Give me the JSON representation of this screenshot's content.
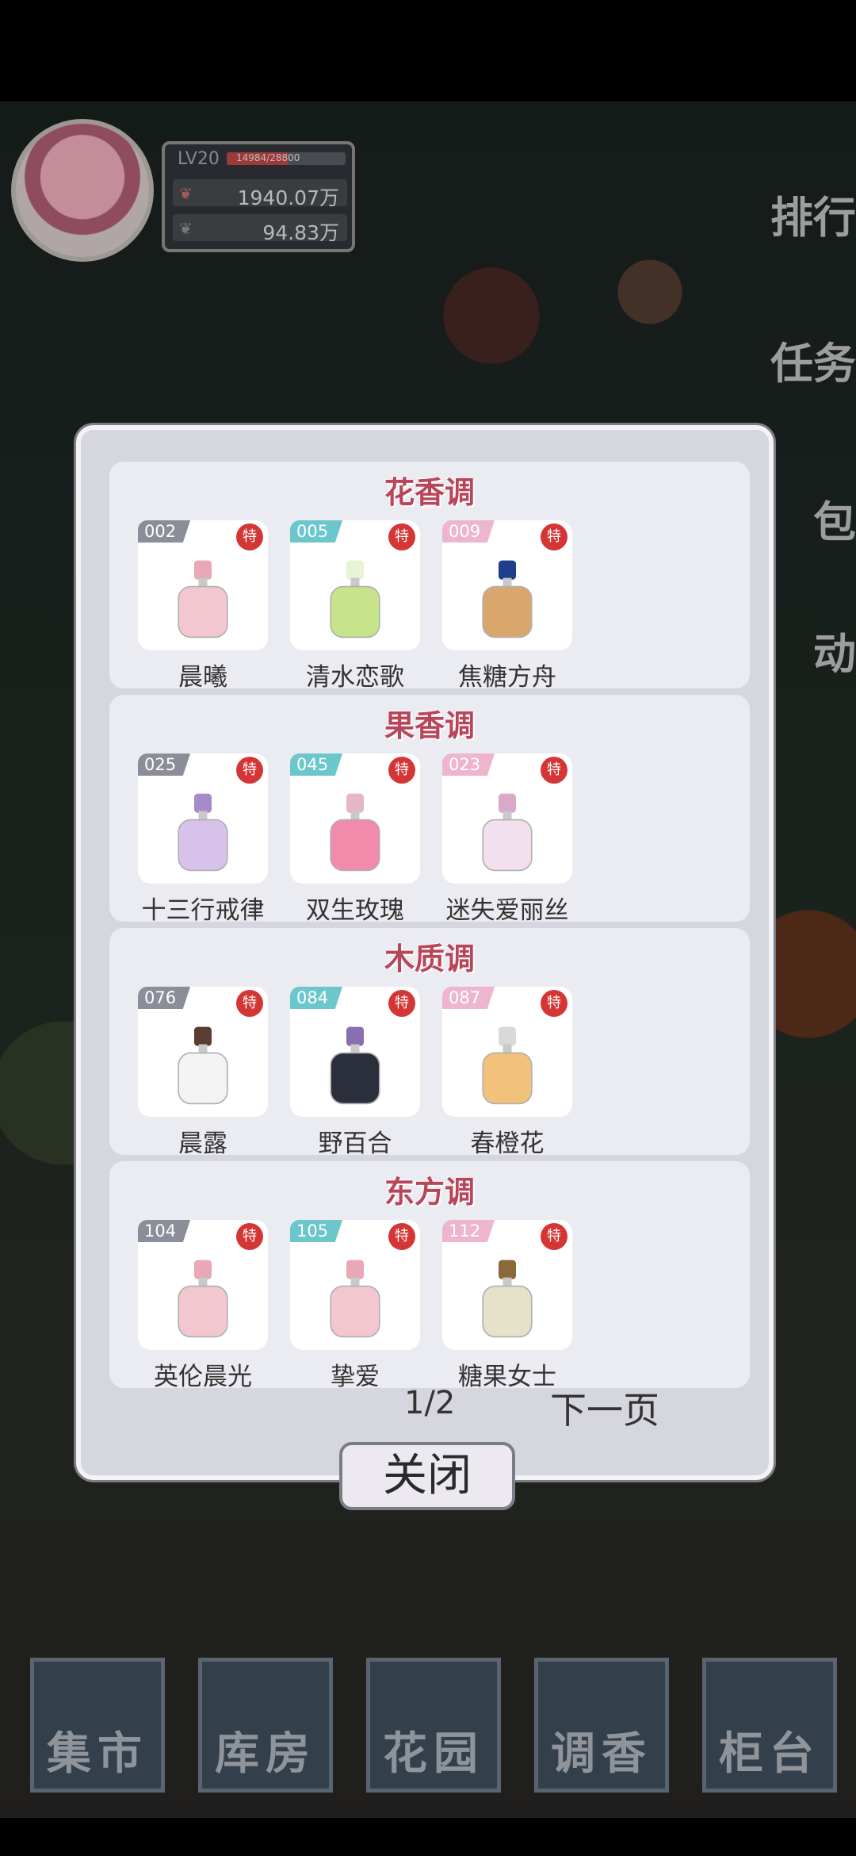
{
  "player": {
    "level": "LV20",
    "exp": "14984/28800",
    "exp_fraction": 0.52,
    "money": "1940.07万",
    "petals": "94.83万"
  },
  "side_menu": [
    "排行",
    "任务",
    "包",
    "动"
  ],
  "bottom_nav": [
    "集市",
    "库房",
    "花园",
    "调香",
    "柜台"
  ],
  "modal": {
    "sections": [
      {
        "title": "花香调",
        "items": [
          {
            "id": "002",
            "name": "晨曦",
            "tag_color": "gray",
            "badge": "特"
          },
          {
            "id": "005",
            "name": "清水恋歌",
            "tag_color": "teal",
            "badge": "特"
          },
          {
            "id": "009",
            "name": "焦糖方舟",
            "tag_color": "pink",
            "badge": "特"
          }
        ]
      },
      {
        "title": "果香调",
        "items": [
          {
            "id": "025",
            "name": "十三行戒律",
            "tag_color": "gray",
            "badge": "特"
          },
          {
            "id": "045",
            "name": "双生玫瑰",
            "tag_color": "teal",
            "badge": "特"
          },
          {
            "id": "023",
            "name": "迷失爱丽丝",
            "tag_color": "pink",
            "badge": "特"
          }
        ]
      },
      {
        "title": "木质调",
        "items": [
          {
            "id": "076",
            "name": "晨露",
            "tag_color": "gray",
            "badge": "特"
          },
          {
            "id": "084",
            "name": "野百合",
            "tag_color": "teal",
            "badge": "特"
          },
          {
            "id": "087",
            "name": "春橙花",
            "tag_color": "pink",
            "badge": "特"
          }
        ]
      },
      {
        "title": "东方调",
        "items": [
          {
            "id": "104",
            "name": "英伦晨光",
            "tag_color": "gray",
            "badge": "特"
          },
          {
            "id": "105",
            "name": "挚爱",
            "tag_color": "teal",
            "badge": "特"
          },
          {
            "id": "112",
            "name": "糖果女士",
            "tag_color": "pink",
            "badge": "特"
          }
        ]
      }
    ],
    "page_indicator": "1/2",
    "next_label": "下一页",
    "close_label": "关闭"
  },
  "colors": {
    "section_title": "#b8455a",
    "badge": "#d43636",
    "modal_bg": "#d5d6de"
  }
}
